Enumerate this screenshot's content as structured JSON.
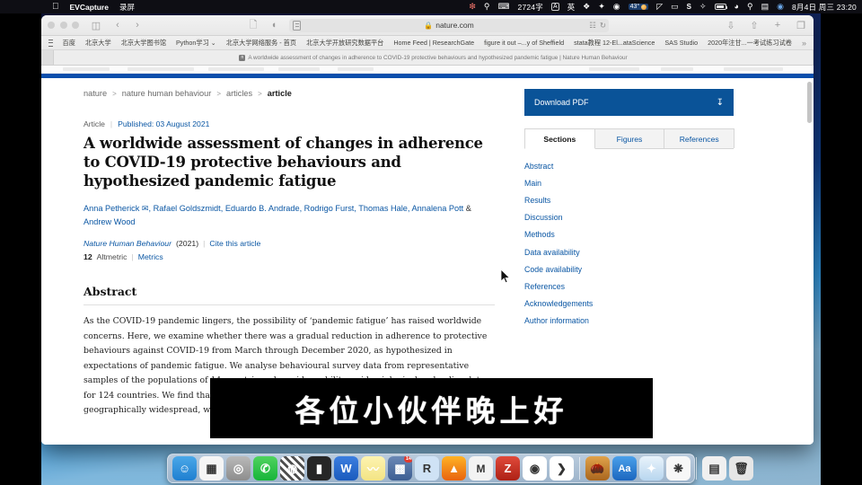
{
  "menubar": {
    "app_name": "EVCapture",
    "menu_items": [
      "录屏"
    ],
    "apple_icon": "apple-logo",
    "right_items": [
      {
        "name": "flower-icon",
        "glyph": "✿"
      },
      {
        "name": "search-spotlight-icon",
        "glyph": "⌕"
      },
      {
        "name": "input-source-icon",
        "glyph": "⌨"
      },
      {
        "name": "word-count",
        "glyph": "2724字"
      },
      {
        "name": "input-method-abc",
        "glyph": "A"
      },
      {
        "name": "input-method-chinese",
        "glyph": "英"
      },
      {
        "name": "dropbox-icon",
        "glyph": "❖"
      },
      {
        "name": "wechat-icon",
        "glyph": "✦"
      },
      {
        "name": "clock-app-icon",
        "glyph": "◉"
      },
      {
        "name": "weather-temp",
        "glyph": "43°"
      },
      {
        "name": "time-machine-icon",
        "glyph": "◷"
      },
      {
        "name": "display-icon",
        "glyph": "▭"
      },
      {
        "name": "sogou-icon",
        "glyph": "S"
      },
      {
        "name": "bluetooth-icon",
        "glyph": "✧"
      },
      {
        "name": "battery-icon",
        "glyph": ""
      },
      {
        "name": "wifi-icon",
        "glyph": "◗"
      },
      {
        "name": "spotlight-icon",
        "glyph": "⌕"
      },
      {
        "name": "control-center-icon",
        "glyph": "▤"
      },
      {
        "name": "siri-icon",
        "glyph": "◉"
      }
    ],
    "word_count": "2724字",
    "temperature": "43°",
    "datetime": "8月4日 周三  23:20"
  },
  "safari": {
    "url": "nature.com",
    "lock": "🔒",
    "toolbar_icons": {
      "sidebar": "sidebar-icon",
      "back": "‹",
      "forward": "›",
      "reader": "reader-icon",
      "privacy": "privacy-report-icon",
      "downloads": "downloads-icon",
      "share": "share-icon",
      "newtab": "+",
      "tabs": "tab-overview-icon",
      "reload": "⟳",
      "extensions": "extensions-icon"
    },
    "bookmarks": [
      "百度",
      "北京大学",
      "北京大学图书馆",
      "Python学习 ⌄",
      "北京大学网络服务 - 首页",
      "北京大学开放研究数据平台",
      "Home Feed | ResearchGate",
      "figure it out –...y of Sheffield",
      "stata教程 12-El...ataScience",
      "SAS Studio",
      "2020年注甘...一考试练习试卷"
    ],
    "bookmarks_overflow": "»",
    "tab_title": "A worldwide assessment of changes in adherence to COVID-19 protective behaviours and hypothesized pandemic fatigue | Nature Human Behaviour"
  },
  "page": {
    "breadcrumb": [
      "nature",
      "nature human behaviour",
      "articles",
      "article"
    ],
    "breadcrumb_sep": ">",
    "article_type": "Article",
    "published_label": "Published: 03 August 2021",
    "title": "A worldwide assessment of changes in adherence to COVID-19 protective behaviours and hypothesized pandemic fatigue",
    "authors_line": "Anna Petherick ✉, Rafael Goldszmidt, Eduardo B. Andrade, Rodrigo Furst, Thomas Hale, Annalena Pott",
    "authors_line2_amp": "&",
    "authors_line2": "Andrew Wood",
    "journal_name": "Nature Human Behaviour",
    "journal_year": "(2021)",
    "cite_link": "Cite this article",
    "altmetric_number": "12",
    "altmetric_label": "Altmetric",
    "metrics_link": "Metrics",
    "abstract_heading": "Abstract",
    "abstract_text": "As the COVID-19 pandemic lingers, the possibility of ‘pandemic fatigue’ has raised worldwide concerns. Here, we examine whether there was a gradual reduction in adherence to protective behaviours against COVID-19 from March through December 2020, as hypothesized in expectations of pandemic fatigue. We analyse behavioural survey data from representative samples of the populations of 14 countries, alongside mobility, epidemiological and policy data for 124 countries. We find that declines in adherence were empirically meaningful and geographically widespread, while a low-cost and non-intrusive"
  },
  "sidebar": {
    "download_label": "Download PDF",
    "download_icon": "download-icon",
    "tabs": [
      {
        "label": "Sections",
        "active": true
      },
      {
        "label": "Figures",
        "active": false
      },
      {
        "label": "References",
        "active": false
      }
    ],
    "sections": [
      "Abstract",
      "Main",
      "Results",
      "Discussion",
      "Methods",
      "Data availability",
      "Code availability",
      "References",
      "Acknowledgements",
      "Author information"
    ]
  },
  "overlay": {
    "caption": "各位小伙伴晚上好"
  },
  "dock": {
    "items": [
      {
        "name": "finder",
        "glyph": "☺",
        "bg": "linear-gradient(#4aa8e8,#1f7fd0)",
        "running": true
      },
      {
        "name": "launchpad",
        "glyph": "▦",
        "bg": "#f5f5f5",
        "running": false
      },
      {
        "name": "safari-tech-preview",
        "glyph": "◎",
        "bg": "linear-gradient(#b9b9b9,#8d8d8d)",
        "running": false
      },
      {
        "name": "wechat",
        "glyph": "✆",
        "bg": "linear-gradient(#4fd35e,#17b43a)",
        "running": true
      },
      {
        "name": "vlc-or-stripes",
        "glyph": "◍",
        "bg": "repeating-linear-gradient(45deg,#fff 0 3px,#4d4d4d 3px 6px)",
        "running": false
      },
      {
        "name": "terminal",
        "glyph": "▮",
        "bg": "#262626",
        "running": false
      },
      {
        "name": "microsoft-word",
        "glyph": "W",
        "bg": "linear-gradient(#3b7ee0,#1b5bbd)",
        "running": true
      },
      {
        "name": "stickies",
        "glyph": "〰",
        "bg": "linear-gradient(#fdf3b0,#f3e484)",
        "running": false
      },
      {
        "name": "calendar-grid",
        "glyph": "▩",
        "bg": "linear-gradient(#6a88b5,#3e5f93)",
        "running": false,
        "badge": "14"
      },
      {
        "name": "rstudio",
        "glyph": "R",
        "bg": "#cfe2f5",
        "running": false
      },
      {
        "name": "acrobat",
        "glyph": "▲",
        "bg": "linear-gradient(#ffb224,#e8630f)",
        "running": false
      },
      {
        "name": "mathtype-mplus8",
        "glyph": "M",
        "bg": "#f3f3f3",
        "running": false
      },
      {
        "name": "zotero",
        "glyph": "Z",
        "bg": "linear-gradient(#e04a3a,#ad2116)",
        "running": false
      },
      {
        "name": "google-chrome",
        "glyph": "◉",
        "bg": "#ffffff",
        "running": true
      },
      {
        "name": "sublime-or-blue-app",
        "glyph": "❯",
        "bg": "#ffffff",
        "running": true
      },
      {
        "name": "acorn-or-mail",
        "glyph": "🌰",
        "bg": "linear-gradient(#e0a24a,#a9661f)",
        "running": true
      },
      {
        "name": "dictionary",
        "glyph": "Aa",
        "bg": "linear-gradient(#4aa0ea,#1c66bf)",
        "running": true
      },
      {
        "name": "safari",
        "glyph": "✦",
        "bg": "linear-gradient(#e9f3fb,#b8d6ef)",
        "running": true
      },
      {
        "name": "photos-or-flower",
        "glyph": "❋",
        "bg": "#f7f7f7",
        "running": false
      },
      {
        "name": "downloads-stack",
        "glyph": "▤",
        "bg": "#f0f0f0",
        "running": false
      },
      {
        "name": "trash",
        "glyph": "🗑",
        "bg": "#e6e6e6",
        "running": false
      }
    ]
  },
  "colors": {
    "nature_blue": "#0a4eab",
    "link_blue": "#0b57a4",
    "download_btn": "#0a5398"
  }
}
